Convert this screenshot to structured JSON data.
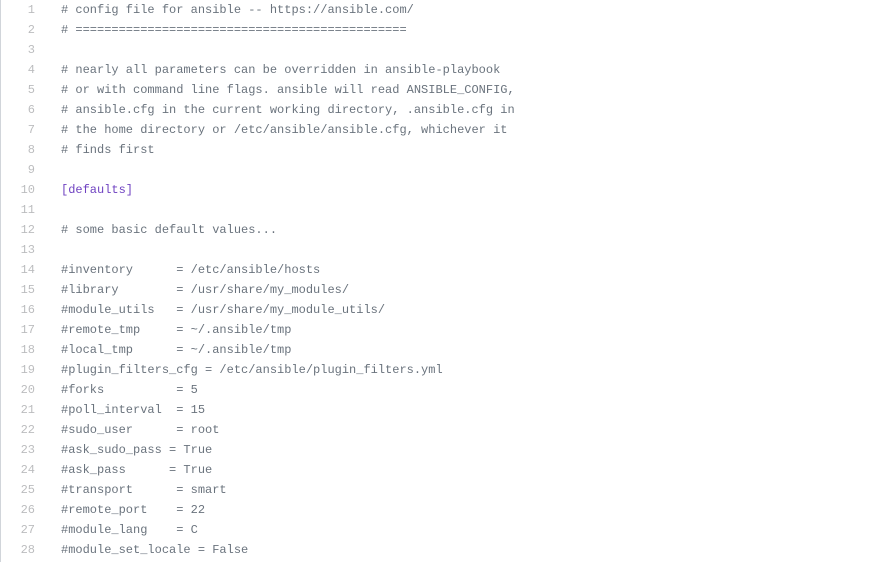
{
  "file": {
    "lines": [
      {
        "n": 1,
        "segments": [
          {
            "cls": "comment",
            "t": "# config file for ansible -- https://ansible.com/"
          }
        ]
      },
      {
        "n": 2,
        "segments": [
          {
            "cls": "comment",
            "t": "# =============================================="
          }
        ]
      },
      {
        "n": 3,
        "segments": []
      },
      {
        "n": 4,
        "segments": [
          {
            "cls": "comment",
            "t": "# nearly all parameters can be overridden in ansible-playbook"
          }
        ]
      },
      {
        "n": 5,
        "segments": [
          {
            "cls": "comment",
            "t": "# or with command line flags. ansible will read ANSIBLE_CONFIG,"
          }
        ]
      },
      {
        "n": 6,
        "segments": [
          {
            "cls": "comment",
            "t": "# ansible.cfg in the current working directory, .ansible.cfg in"
          }
        ]
      },
      {
        "n": 7,
        "segments": [
          {
            "cls": "comment",
            "t": "# the home directory or /etc/ansible/ansible.cfg, whichever it"
          }
        ]
      },
      {
        "n": 8,
        "segments": [
          {
            "cls": "comment",
            "t": "# finds first"
          }
        ]
      },
      {
        "n": 9,
        "segments": []
      },
      {
        "n": 10,
        "segments": [
          {
            "cls": "section",
            "t": "[defaults]"
          }
        ]
      },
      {
        "n": 11,
        "segments": []
      },
      {
        "n": 12,
        "segments": [
          {
            "cls": "comment",
            "t": "# some basic default values..."
          }
        ]
      },
      {
        "n": 13,
        "segments": []
      },
      {
        "n": 14,
        "segments": [
          {
            "cls": "comment",
            "t": "#inventory      = /etc/ansible/hosts"
          }
        ]
      },
      {
        "n": 15,
        "segments": [
          {
            "cls": "comment",
            "t": "#library        = /usr/share/my_modules/"
          }
        ]
      },
      {
        "n": 16,
        "segments": [
          {
            "cls": "comment",
            "t": "#module_utils   = /usr/share/my_module_utils/"
          }
        ]
      },
      {
        "n": 17,
        "segments": [
          {
            "cls": "comment",
            "t": "#remote_tmp     = ~/.ansible/tmp"
          }
        ]
      },
      {
        "n": 18,
        "segments": [
          {
            "cls": "comment",
            "t": "#local_tmp      = ~/.ansible/tmp"
          }
        ]
      },
      {
        "n": 19,
        "segments": [
          {
            "cls": "comment",
            "t": "#plugin_filters_cfg = /etc/ansible/plugin_filters.yml"
          }
        ]
      },
      {
        "n": 20,
        "segments": [
          {
            "cls": "comment",
            "t": "#forks          = 5"
          }
        ]
      },
      {
        "n": 21,
        "segments": [
          {
            "cls": "comment",
            "t": "#poll_interval  = 15"
          }
        ]
      },
      {
        "n": 22,
        "segments": [
          {
            "cls": "comment",
            "t": "#sudo_user      = root"
          }
        ]
      },
      {
        "n": 23,
        "segments": [
          {
            "cls": "comment",
            "t": "#ask_sudo_pass = True"
          }
        ]
      },
      {
        "n": 24,
        "segments": [
          {
            "cls": "comment",
            "t": "#ask_pass      = True"
          }
        ]
      },
      {
        "n": 25,
        "segments": [
          {
            "cls": "comment",
            "t": "#transport      = smart"
          }
        ]
      },
      {
        "n": 26,
        "segments": [
          {
            "cls": "comment",
            "t": "#remote_port    = 22"
          }
        ]
      },
      {
        "n": 27,
        "segments": [
          {
            "cls": "comment",
            "t": "#module_lang    = C"
          }
        ]
      },
      {
        "n": 28,
        "segments": [
          {
            "cls": "comment",
            "t": "#module_set_locale = False"
          }
        ]
      }
    ]
  }
}
